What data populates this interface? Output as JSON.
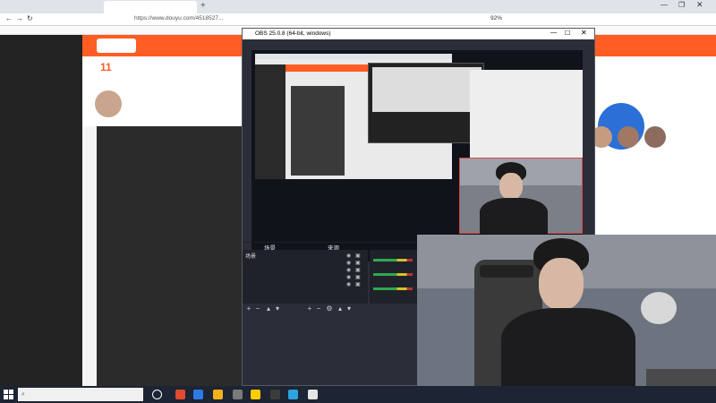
{
  "browser": {
    "tabs": [
      {
        "label": ""
      },
      {
        "label": ""
      }
    ],
    "url": "https://www.douyu.com/4518527...",
    "bookmarks": [
      "",
      "",
      "",
      "",
      "",
      ""
    ],
    "zoom": "92%",
    "right_label": ""
  },
  "douyu": {
    "sidebar_items": [
      {
        "label": "",
        "head": false
      },
      {
        "label": "",
        "head": false
      },
      {
        "label": "",
        "head": false
      },
      {
        "label": "",
        "head": false
      },
      {
        "label": "",
        "head": true
      },
      {
        "label": "",
        "head": false
      },
      {
        "label": "",
        "head": false
      },
      {
        "label": "",
        "head": false
      },
      {
        "label": "",
        "head": true
      },
      {
        "label": "",
        "head": false
      },
      {
        "label": "",
        "head": false
      },
      {
        "label": "",
        "head": true
      },
      {
        "label": "",
        "head": false
      },
      {
        "label": "",
        "head": false
      }
    ],
    "nav_items": [
      "",
      "",
      "",
      ""
    ],
    "room_title": "",
    "big_number": "11"
  },
  "obs": {
    "title": "OBS 25.0.8 (64-bit, windows)",
    "menu": [
      "",
      "",
      "",
      "",
      "",
      "",
      ""
    ],
    "scenes_title": "场景",
    "sources_title": "来源",
    "scene_item": "场景",
    "sources": [
      "",
      "",
      "",
      "",
      "",
      "",
      ""
    ]
  },
  "taskbar": {
    "search_placeholder": "",
    "icon_colors": [
      "#e04a2f",
      "#2d7be5",
      "#f2b21c",
      "#7a7a7a",
      "#ffcc00",
      "#3c3c3c",
      "#2fa3e0",
      "#e5e5e5"
    ]
  },
  "colors": {
    "brand": "#ff5d23",
    "obs_bg": "#2b2e38"
  }
}
